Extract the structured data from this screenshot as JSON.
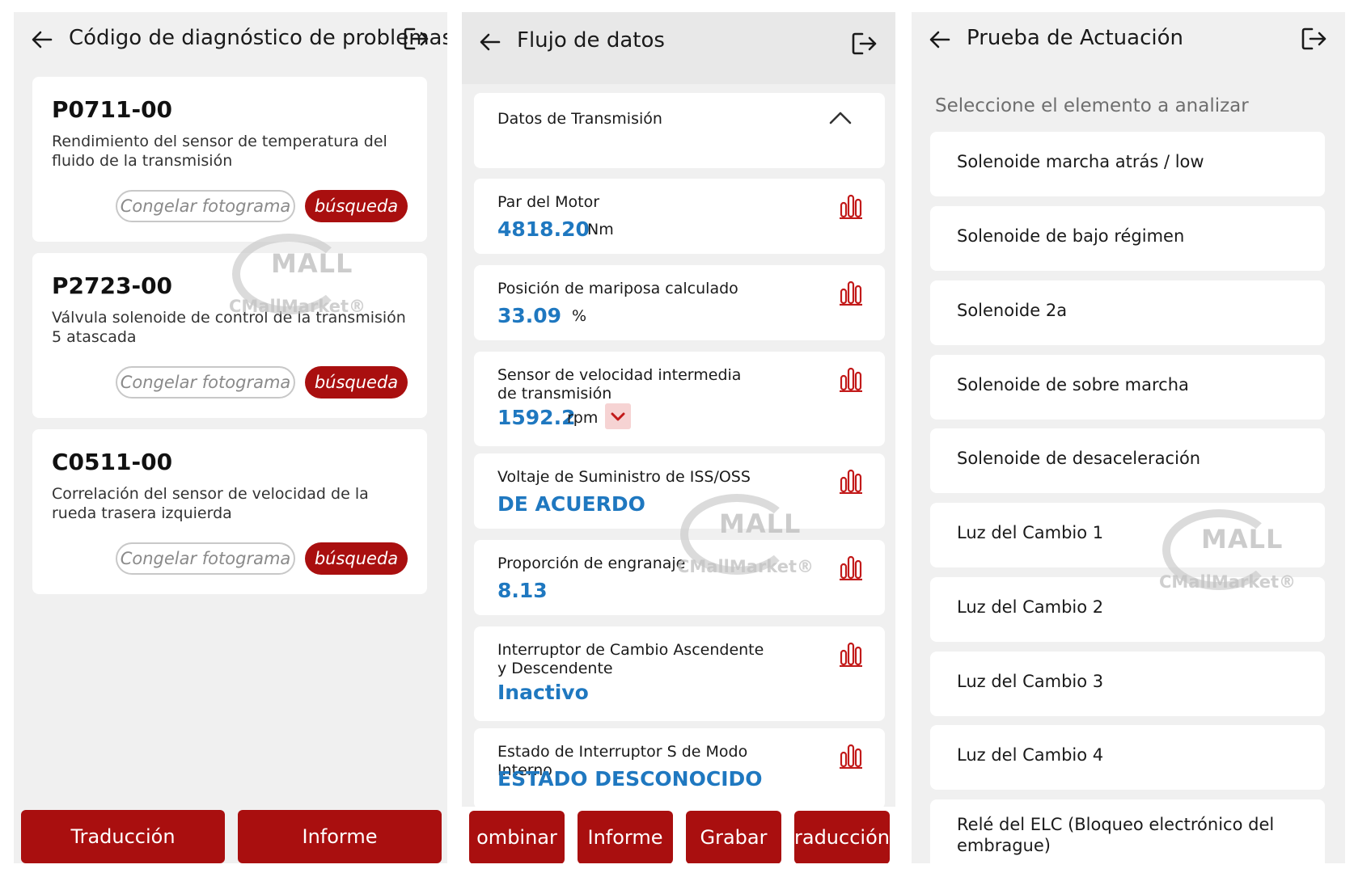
{
  "colors": {
    "accent": "#a90f0f",
    "value_blue": "#1f78c0",
    "panel_bg": "#f0f0f0"
  },
  "watermark": {
    "mall": "MALL",
    "market": "CMallMarket®"
  },
  "panel1": {
    "title": "Código de diagnóstico de problemas",
    "cards": [
      {
        "code": "P0711-00",
        "desc": "Rendimiento del sensor de temperatura del fluido de la transmisión",
        "freeze": "Congelar fotograma",
        "search": "búsqueda"
      },
      {
        "code": "P2723-00",
        "desc": "Válvula solenoide de control de la transmisión 5 atascada",
        "freeze": "Congelar fotograma",
        "search": "búsqueda"
      },
      {
        "code": "C0511-00",
        "desc": "Correlación del sensor de velocidad de la rueda trasera izquierda",
        "freeze": "Congelar fotograma",
        "search": "búsqueda"
      }
    ],
    "bottom": {
      "translate": "Traducción",
      "report": "Informe"
    }
  },
  "panel2": {
    "title": "Flujo de datos",
    "section": "Datos de Transmisión",
    "rows": [
      {
        "name": "Par del Motor",
        "value": "4818.20",
        "unit": "Nm"
      },
      {
        "name": "Posición de mariposa calculado",
        "value": "33.09",
        "unit": "%"
      },
      {
        "name": "Sensor de velocidad intermedia de transmisión",
        "value": "1592.2",
        "unit": "rpm"
      },
      {
        "name": "Voltaje de Suministro de ISS/OSS",
        "value": "DE ACUERDO",
        "unit": ""
      },
      {
        "name": "Proporción de engranaje",
        "value": "8.13",
        "unit": ""
      },
      {
        "name": "Interruptor de Cambio Ascendente y Descendente",
        "value": "Inactivo",
        "unit": ""
      },
      {
        "name": "Estado de Interruptor S de Modo Interno",
        "value": "ESTADO DESCONOCIDO",
        "unit": ""
      }
    ],
    "bottom": {
      "combine": "ombinar",
      "report": "Informe",
      "record": "Grabar",
      "translate": "raducción"
    }
  },
  "panel3": {
    "title": "Prueba de Actuación",
    "subtitle": "Seleccione el elemento a analizar",
    "items": [
      "Solenoide marcha atrás / low",
      "Solenoide de bajo régimen",
      "Solenoide 2a",
      "Solenoide de sobre marcha",
      "Solenoide de desaceleración",
      "Luz del Cambio 1",
      "Luz del Cambio 2",
      "Luz del Cambio 3",
      "Luz del Cambio 4",
      "Relé del ELC (Bloqueo electrónico del embrague)"
    ]
  }
}
